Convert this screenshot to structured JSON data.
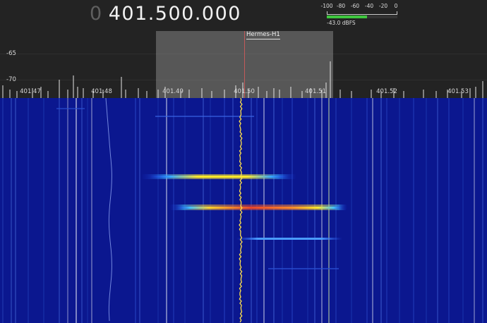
{
  "frequency": {
    "leading_digit": "0",
    "value": "401.500.000"
  },
  "meter": {
    "ticks": [
      "-100",
      "-80",
      "-60",
      "-40",
      "-20",
      "0"
    ],
    "level_dbfs": -43.0,
    "readout": "-43.0 dBFS"
  },
  "spectrum": {
    "db_labels": [
      "-65",
      "-70"
    ],
    "freq_labels": [
      "401.47",
      "401.48",
      "401.49",
      "401.50",
      "401.51",
      "401.52",
      "401.53"
    ],
    "station_label": "Hermes-H1"
  },
  "colors": {
    "waterfall_bg": "#0b178f",
    "passband": "#969696",
    "center_marker": "#c25a5a",
    "meter_fill": "#3ec63e"
  }
}
